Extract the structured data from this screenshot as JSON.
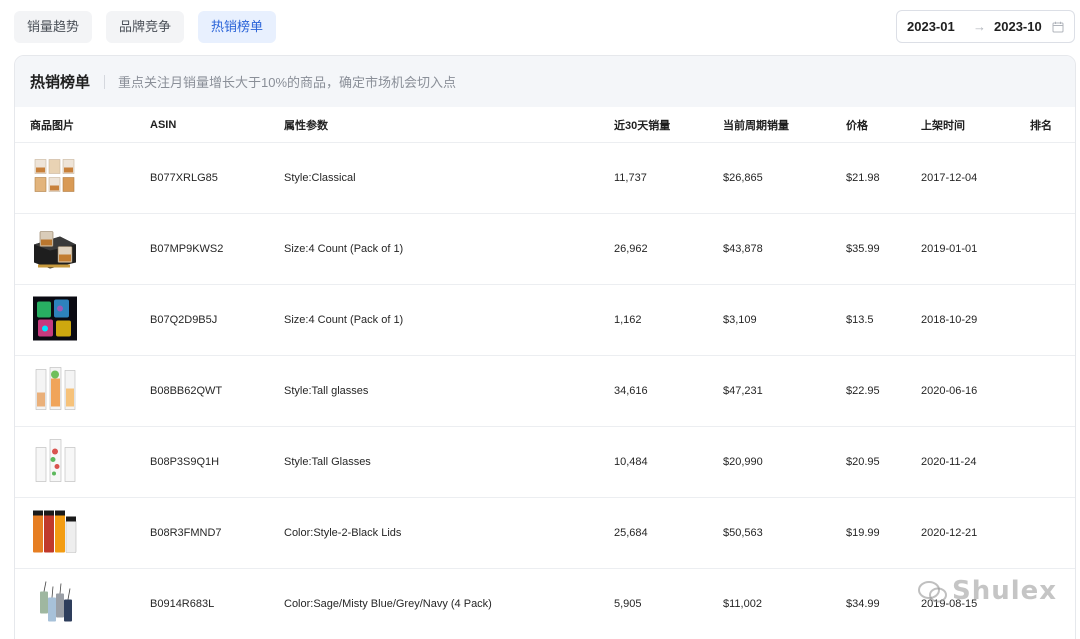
{
  "tabs": [
    {
      "label": "销量趋势",
      "active": false
    },
    {
      "label": "品牌竞争",
      "active": false
    },
    {
      "label": "热销榜单",
      "active": true
    }
  ],
  "date_range": {
    "start": "2023-01",
    "arrow": "→",
    "end": "2023-10",
    "icon": "calendar-icon"
  },
  "card": {
    "title": "热销榜单",
    "subtitle": "重点关注月销量增长大于10%的商品，确定市场机会切入点"
  },
  "table": {
    "headers": {
      "image": "商品图片",
      "asin": "ASIN",
      "attr": "属性参数",
      "sales30": "近30天销量",
      "current": "当前周期销量",
      "price": "价格",
      "date": "上架时间",
      "rank": "排名"
    },
    "rows": [
      {
        "asin": "B077XRLG85",
        "attr": "Style:Classical",
        "sales30": "11,737",
        "current": "$26,865",
        "price": "$21.98",
        "date": "2017-12-04",
        "thumb": "whiskey-glass-set"
      },
      {
        "asin": "B07MP9KWS2",
        "attr": "Size:4 Count (Pack of 1)",
        "sales30": "26,962",
        "current": "$43,878",
        "price": "$35.99",
        "date": "2019-01-01",
        "thumb": "glasses-gift-box"
      },
      {
        "asin": "B07Q2D9B5J",
        "attr": "Size:4 Count (Pack of 1)",
        "sales30": "1,162",
        "current": "$3,109",
        "price": "$13.5",
        "date": "2018-10-29",
        "thumb": "led-glow-cups"
      },
      {
        "asin": "B08BB62QWT",
        "attr": "Style:Tall glasses",
        "sales30": "34,616",
        "current": "$47,231",
        "price": "$22.95",
        "date": "2020-06-16",
        "thumb": "tall-glasses-drinks"
      },
      {
        "asin": "B08P3S9Q1H",
        "attr": "Style:Tall Glasses",
        "sales30": "10,484",
        "current": "$20,990",
        "price": "$20.95",
        "date": "2020-11-24",
        "thumb": "tall-glasses-clear"
      },
      {
        "asin": "B08R3FMND7",
        "attr": "Color:Style-2-Black Lids",
        "sales30": "25,684",
        "current": "$50,563",
        "price": "$19.99",
        "date": "2020-12-21",
        "thumb": "juice-bottles"
      },
      {
        "asin": "B0914R683L",
        "attr": "Color:Sage/Misty Blue/Grey/Navy (4 Pack)",
        "sales30": "5,905",
        "current": "$11,002",
        "price": "$34.99",
        "date": "2019-08-15",
        "thumb": "tumblers-with-straws"
      }
    ]
  },
  "watermark": {
    "text": "Shulex"
  }
}
